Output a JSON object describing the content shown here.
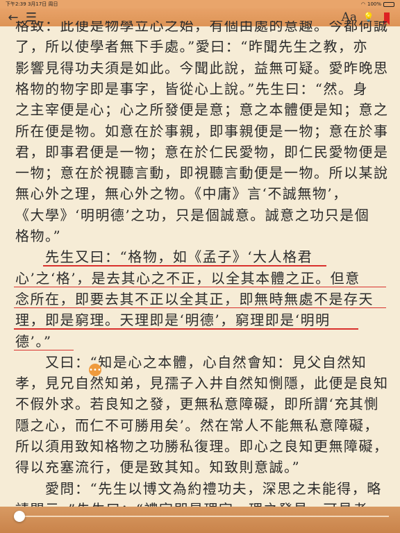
{
  "status": {
    "time_date": "下午2:39  3月17日 周日",
    "wifi": "◠",
    "battery_percent": "100%",
    "battery_level": 1.0
  },
  "toolbar": {
    "back": "←",
    "toc": "☰",
    "font": "Aa",
    "brightness": "💡"
  },
  "lines": [
    "格致：此便是物學立心之始，有個由處的意趣。今都何誠",
    "了，所以使學者無下手處。”愛曰：“昨聞先生之教，亦",
    "影響見得功夫須是如此。今聞此說，益無可疑。愛昨晚思",
    "格物的物字即是事字，皆從心上說。”先生曰：“然。身",
    "之主宰便是心；心之所發便是意；意之本體便是知；意之",
    "所在便是物。如意在於事親，即事親便是一物；意在於事",
    "君，即事君便是一物；意在於仁民愛物，即仁民愛物便是",
    "一物；意在於視聽言動，即視聽言動便是一物。所以某說",
    "無心外之理，無心外之物。《中庸》言‘不誠無物’，",
    "《大學》‘明明德’之功，只是個誠意。誠意之功只是個",
    "格物。”",
    "　　先生又曰：“格物，如《孟子》‘大人格君",
    "心’之‘格’，是去其心之不正，以全其本體之正。但意",
    "念所在，即要去其不正以全其正，即無時無處不是存天",
    "理，即是窮理。天理即是‘明德’，窮理即是‘明明",
    "德’。”",
    "　　又曰：“知是心之本體，心自然會知：見父自然知",
    "孝，見兄自然知弟，見孺子入井自然知惻隱，此便是良知",
    "不假外求。若良知之發，更無私意障礙，即所謂‘充其惻",
    "隱之心，而仁不可勝用矣’。然在常人不能無私意障礙，",
    "所以須用致知格物之功勝私復理。即心之良知更無障礙，",
    "得以充塞流行，便是致其知。知致則意誠。”",
    "　　愛問：“先生以博文為約禮功夫，深思之未能得，略",
    "請開示。”先生曰：“禮字即是理字。理之發見，可見者"
  ],
  "note_icon": "•••",
  "progress": {
    "fraction": 0.0
  }
}
